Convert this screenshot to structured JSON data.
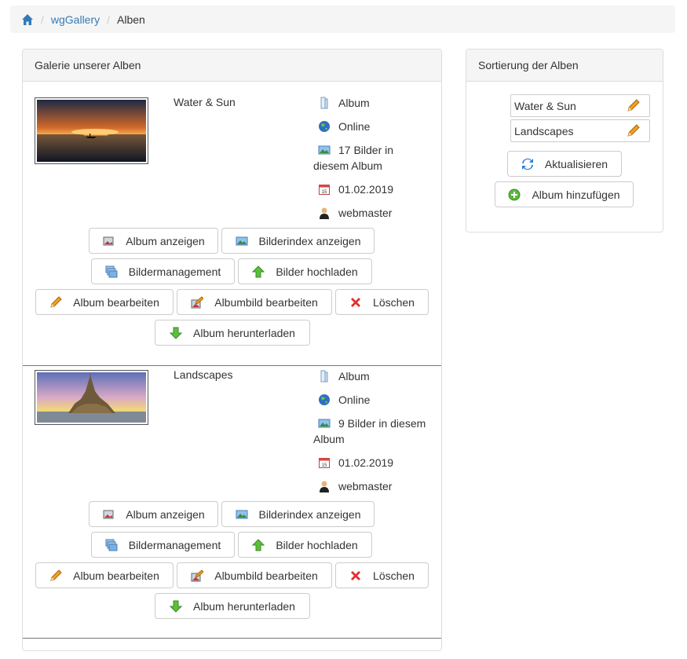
{
  "breadcrumb": {
    "home_icon": "home-icon",
    "module": "wgGallery",
    "current": "Alben",
    "link_color": "#337ab7"
  },
  "gallery": {
    "heading": "Galerie unserer Alben",
    "albums": [
      {
        "title": "Water & Sun",
        "type": "Album",
        "status": "Online",
        "count_line1": "17 Bilder in",
        "count_line2": "diesem Album",
        "date": "01.02.2019",
        "author": "webmaster"
      },
      {
        "title": "Landscapes",
        "type": "Album",
        "status": "Online",
        "count_line1": "9 Bilder in diesem",
        "count_line2": "Album",
        "date": "01.02.2019",
        "author": "webmaster"
      }
    ],
    "buttons": {
      "show_album": "Album anzeigen",
      "show_index": "Bilderindex anzeigen",
      "manage_images": "Bildermanagement",
      "upload_images": "Bilder hochladen",
      "edit_album": "Album bearbeiten",
      "edit_album_image": "Albumbild bearbeiten",
      "delete": "Löschen",
      "download_album": "Album herunterladen"
    }
  },
  "sort": {
    "heading": "Sortierung der Alben",
    "items": [
      "Water & Sun",
      "Landscapes"
    ],
    "refresh_label": "Aktualisieren",
    "add_label": "Album hinzufügen"
  }
}
